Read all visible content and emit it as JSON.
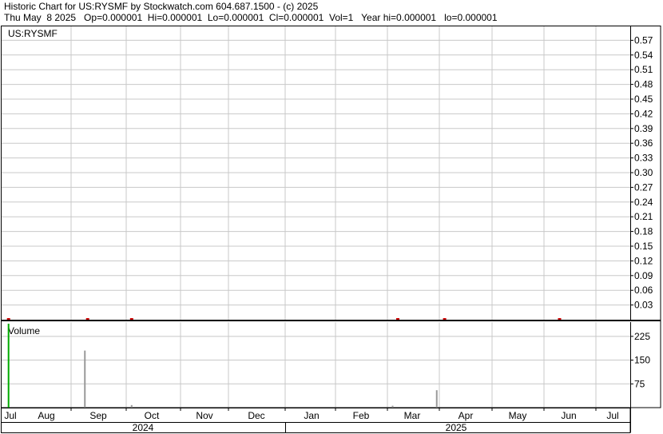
{
  "header": {
    "line1": "Historic Chart for US:RYSMF by Stockwatch.com 604.687.1500 - (c) 2025",
    "line2": "Thu May  8 2025   Op=0.000001  Hi=0.000001  Lo=0.000001  Cl=0.000001  Vol=1   Year hi=0.000001   lo=0.000001"
  },
  "chart_data": {
    "type": "line",
    "title": "US:RYSMF",
    "price_axis": {
      "ylim": [
        0,
        0.6
      ],
      "ticks": [
        "0.57",
        "0.54",
        "0.51",
        "0.48",
        "0.45",
        "0.42",
        "0.39",
        "0.36",
        "0.33",
        "0.30",
        "0.27",
        "0.24",
        "0.21",
        "0.18",
        "0.15",
        "0.12",
        "0.09",
        "0.06",
        "0.03"
      ]
    },
    "volume_axis": {
      "label": "Volume",
      "ylim": [
        0,
        270
      ],
      "ticks": [
        "225",
        "150",
        "75"
      ]
    },
    "x_axis": {
      "months": [
        "Jul",
        "Aug",
        "Sep",
        "Oct",
        "Nov",
        "Dec",
        "Jan",
        "Feb",
        "Mar",
        "Apr",
        "May",
        "Jun",
        "Jul"
      ],
      "years": [
        "2024",
        "2025"
      ]
    },
    "price_points": [
      {
        "x": 0.1,
        "y": 1e-06
      },
      {
        "x": 1.3,
        "y": 1e-06
      },
      {
        "x": 2.1,
        "y": 1e-06
      },
      {
        "x": 7.2,
        "y": 1e-06
      },
      {
        "x": 8.1,
        "y": 1e-06
      },
      {
        "x": 10.3,
        "y": 1e-06
      }
    ],
    "volume_bars": [
      {
        "x": 0.1,
        "v": 265,
        "color": "#00aa00"
      },
      {
        "x": 1.25,
        "v": 180,
        "color": "#999999"
      },
      {
        "x": 2.1,
        "v": 8,
        "color": "#999999"
      },
      {
        "x": 7.1,
        "v": 6,
        "color": "#999999"
      },
      {
        "x": 7.95,
        "v": 55,
        "color": "#999999"
      }
    ],
    "grid": true
  },
  "colors": {
    "grid": "#c8c8c8",
    "price_marker": "#cc0000",
    "axis": "#000000"
  }
}
